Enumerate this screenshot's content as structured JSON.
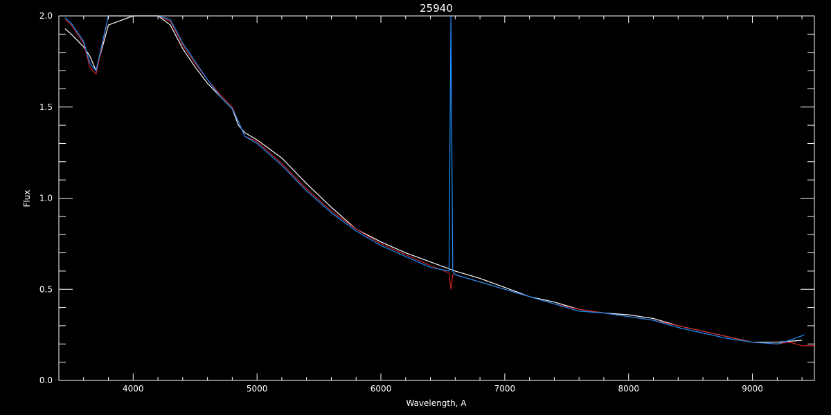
{
  "chart_data": {
    "type": "line",
    "title": "25940",
    "xlabel": "Wavelength, A",
    "ylabel": "Flux",
    "xlim": [
      3400,
      9500
    ],
    "ylim": [
      0.0,
      2.0
    ],
    "x_ticks": [
      4000,
      5000,
      6000,
      7000,
      8000,
      9000
    ],
    "x_tick_labels": [
      "4000",
      "5000",
      "6000",
      "7000",
      "8000",
      "9000"
    ],
    "y_ticks": [
      0.0,
      0.5,
      1.0,
      1.5,
      2.0
    ],
    "y_tick_labels": [
      "0.0",
      "0.5",
      "1.0",
      "1.5",
      "2.0"
    ],
    "grid": false,
    "background": "#000000",
    "axis_color": "#ffffff",
    "series": [
      {
        "color": "#ffffff",
        "x": [
          3450,
          3500,
          3600,
          3650,
          3700,
          3800,
          4000,
          4200,
          4300,
          4400,
          4500,
          4600,
          4700,
          4800,
          4850,
          4900,
          5000,
          5200,
          5400,
          5600,
          5800,
          6000,
          6200,
          6400,
          6600,
          6800,
          7000,
          7200,
          7400,
          7600,
          7800,
          8000,
          8200,
          8400,
          8600,
          8800,
          9000,
          9200,
          9400
        ],
        "y": [
          1.93,
          1.9,
          1.83,
          1.78,
          1.7,
          1.95,
          2.0,
          2.0,
          1.95,
          1.82,
          1.72,
          1.63,
          1.56,
          1.49,
          1.4,
          1.36,
          1.32,
          1.22,
          1.08,
          0.95,
          0.83,
          0.76,
          0.7,
          0.65,
          0.6,
          0.56,
          0.51,
          0.46,
          0.43,
          0.39,
          0.37,
          0.36,
          0.34,
          0.3,
          0.27,
          0.24,
          0.21,
          0.21,
          0.22
        ]
      },
      {
        "color": "#cc2222",
        "x": [
          3450,
          3500,
          3600,
          3650,
          3700,
          3800,
          4000,
          4200,
          4300,
          4400,
          4500,
          4600,
          4700,
          4800,
          4850,
          4900,
          5000,
          5200,
          5400,
          5600,
          5800,
          6000,
          6200,
          6400,
          6550,
          6565,
          6580,
          6600,
          6800,
          7000,
          7200,
          7400,
          7600,
          7800,
          8000,
          8200,
          8400,
          8600,
          8800,
          9000,
          9200,
          9300,
          9400,
          9500
        ],
        "y": [
          1.98,
          1.95,
          1.85,
          1.72,
          1.68,
          2.0,
          2.0,
          2.0,
          1.97,
          1.84,
          1.74,
          1.65,
          1.57,
          1.5,
          1.42,
          1.34,
          1.31,
          1.19,
          1.05,
          0.93,
          0.83,
          0.75,
          0.69,
          0.63,
          0.59,
          0.5,
          0.58,
          0.58,
          0.54,
          0.5,
          0.46,
          0.42,
          0.39,
          0.37,
          0.35,
          0.33,
          0.3,
          0.27,
          0.24,
          0.21,
          0.2,
          0.21,
          0.19,
          0.19
        ]
      },
      {
        "color": "#1e90ff",
        "x": [
          3450,
          3500,
          3600,
          3650,
          3700,
          3800,
          4000,
          4200,
          4300,
          4400,
          4500,
          4600,
          4700,
          4800,
          4850,
          4900,
          5000,
          5200,
          5400,
          5600,
          5800,
          6000,
          6200,
          6400,
          6550,
          6565,
          6580,
          6600,
          6800,
          7000,
          7200,
          7400,
          7600,
          7800,
          8000,
          8200,
          8400,
          8600,
          8800,
          9000,
          9200,
          9300,
          9420
        ],
        "y": [
          1.99,
          1.96,
          1.86,
          1.74,
          1.7,
          2.0,
          2.0,
          2.0,
          1.98,
          1.85,
          1.75,
          1.65,
          1.56,
          1.49,
          1.42,
          1.34,
          1.3,
          1.18,
          1.04,
          0.92,
          0.82,
          0.74,
          0.68,
          0.62,
          0.6,
          2.0,
          0.6,
          0.58,
          0.54,
          0.5,
          0.46,
          0.42,
          0.38,
          0.37,
          0.35,
          0.33,
          0.29,
          0.26,
          0.23,
          0.21,
          0.2,
          0.22,
          0.25
        ]
      }
    ]
  }
}
